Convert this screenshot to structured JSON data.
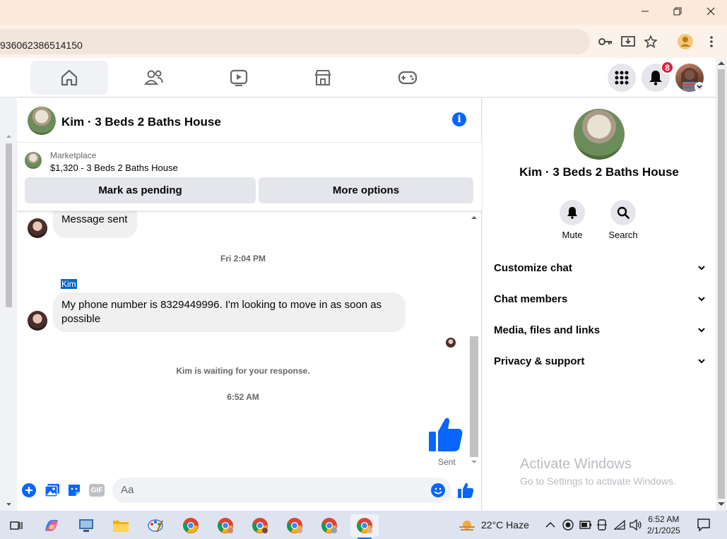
{
  "browser": {
    "url_text": "936062386514150"
  },
  "nav": {
    "notifications_count": "8"
  },
  "chat": {
    "title": "Kim · 3 Beds 2 Baths House",
    "marketplace_label": "Marketplace",
    "listing": "$1,320 - 3 Beds 2 Baths House",
    "mark_pending_label": "Mark as pending",
    "more_options_label": "More options",
    "messages": {
      "msg1": "Message sent",
      "ts1": "Fri 2:04 PM",
      "sender": "Kim",
      "msg2": "My phone number is 8329449996. I'm looking to move in as soon as possible",
      "waiting": "Kim is waiting for your response.",
      "ts2": "6:52 AM",
      "sent_status": "Sent"
    },
    "composer_placeholder": "Aa"
  },
  "panel": {
    "title": "Kim · 3 Beds 2 Baths House",
    "mute_label": "Mute",
    "search_label": "Search",
    "sections": [
      "Customize chat",
      "Chat members",
      "Media, files and links",
      "Privacy & support"
    ]
  },
  "watermark": {
    "line1": "Activate Windows",
    "line2": "Go to Settings to activate Windows."
  },
  "taskbar": {
    "weather": "22°C  Haze",
    "time": "6:52 AM",
    "date": "2/1/2025"
  },
  "colors": {
    "accent": "#0866ff",
    "bubble": "#f0f0f0",
    "badge": "#e41e3f"
  }
}
